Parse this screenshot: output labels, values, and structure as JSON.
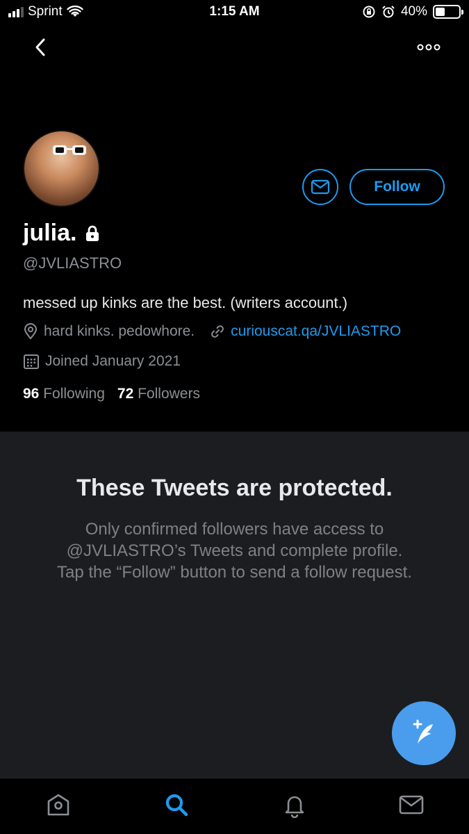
{
  "status_bar": {
    "carrier": "Sprint",
    "time": "1:15 AM",
    "battery": "40%",
    "battery_level": 0.4
  },
  "nav": {
    "back_icon": "chevron-left-icon",
    "more_icon": "more-dots-icon"
  },
  "profile": {
    "display_name": "julia.",
    "handle": "@JVLIASTRO",
    "bio": "messed up kinks are the best. (writers account.)",
    "location": "hard kinks. pedowhore.",
    "website": "curiouscat.qa/JVLIASTRO",
    "joined": "Joined January 2021",
    "following_count": "96",
    "following_label": "Following",
    "followers_count": "72",
    "followers_label": "Followers",
    "follow_button_label": "Follow"
  },
  "protected": {
    "title": "These Tweets are protected.",
    "body": "Only confirmed followers have access to @JVLIASTRO’s Tweets and complete profile. Tap the “Follow” button to send a follow request."
  },
  "tab_bar": {
    "items": [
      "home-icon",
      "search-icon",
      "notifications-icon",
      "messages-icon"
    ],
    "active": "search-icon"
  },
  "colors": {
    "accent": "#1d9bf0",
    "background": "#000000",
    "panel": "#1c1d20",
    "secondary_text": "#8b8f94"
  }
}
